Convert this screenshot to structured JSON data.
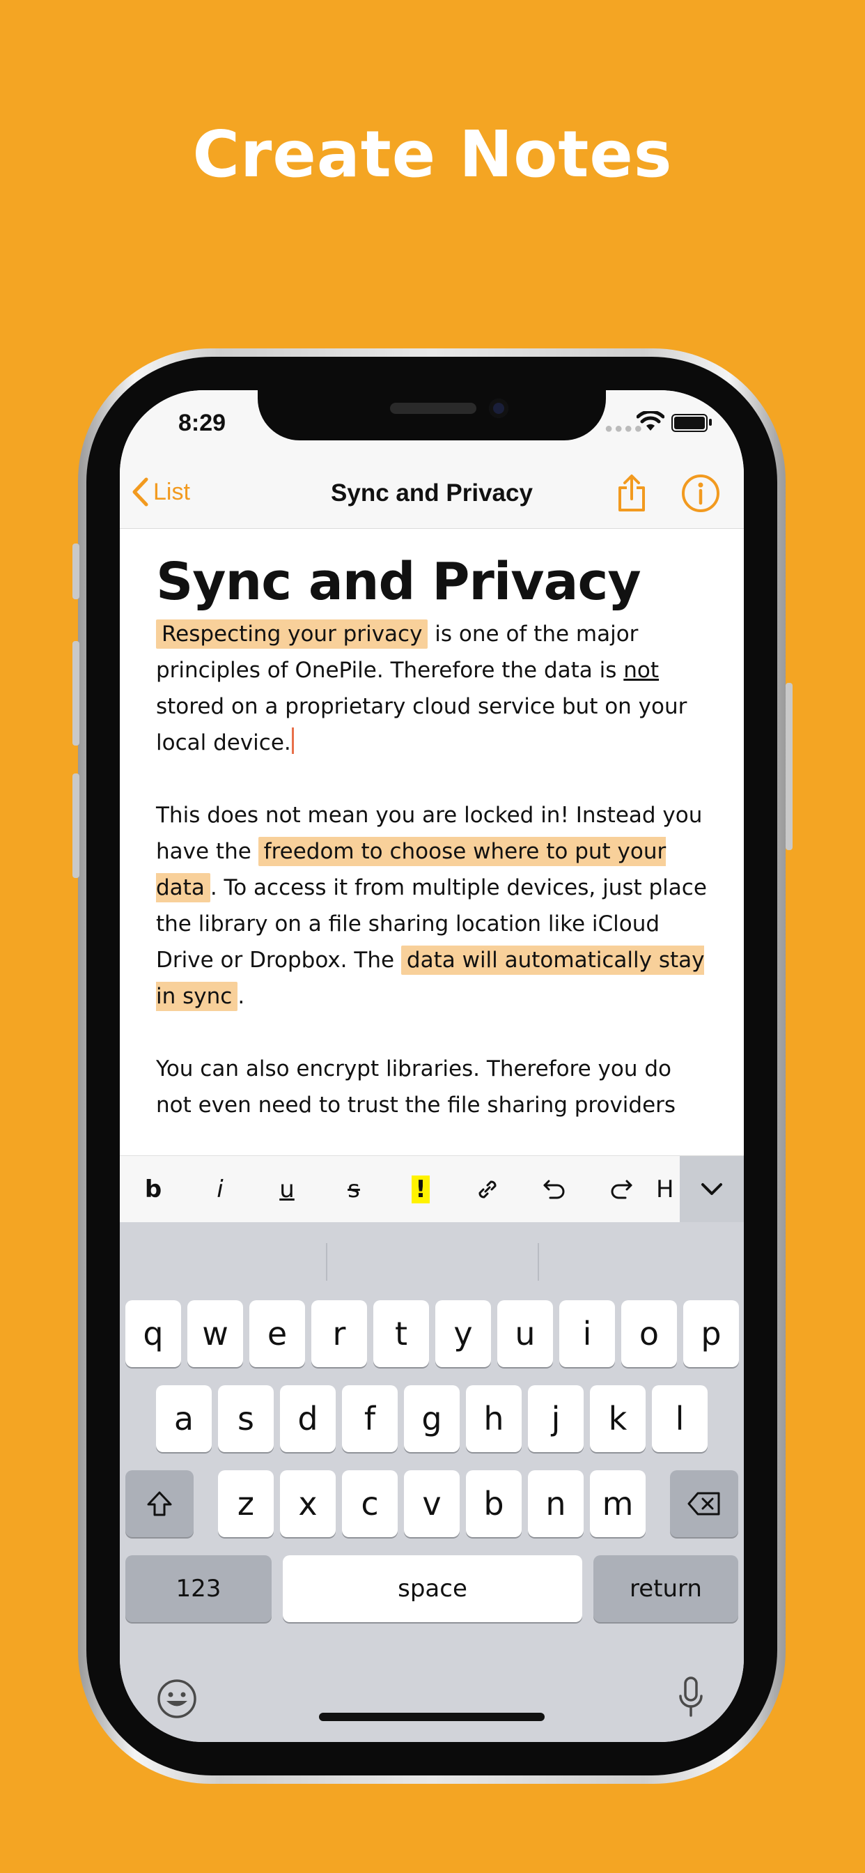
{
  "banner": {
    "headline": "Create Notes"
  },
  "status": {
    "time": "8:29"
  },
  "nav": {
    "back_label": "List",
    "title": "Sync and Privacy"
  },
  "note": {
    "title": "Sync and Privacy",
    "p1": {
      "hl1": "Respecting your privacy",
      "t1": " is one of the major principles of OnePile. Therefore the data is ",
      "u1": "not",
      "t2": " stored on a proprietary cloud service but on your local device."
    },
    "p2": {
      "t1": "This does not mean you are locked in! Instead you have the ",
      "hl1": "freedom to choose where to put your data",
      "t2": ". To access it from multiple devices, just place the library on a file sharing location like iCloud Drive or Dropbox. The ",
      "hl2": "data will automatically stay in sync",
      "t3": "."
    },
    "p3": {
      "t1": "You can also encrypt libraries. Therefore you do not even need to trust the file sharing providers"
    }
  },
  "format_toolbar": {
    "bold": "b",
    "italic": "i",
    "underline": "u",
    "strike": "s",
    "highlight": "!",
    "heading": "H"
  },
  "keyboard": {
    "row1": [
      "q",
      "w",
      "e",
      "r",
      "t",
      "y",
      "u",
      "i",
      "o",
      "p"
    ],
    "row2": [
      "a",
      "s",
      "d",
      "f",
      "g",
      "h",
      "j",
      "k",
      "l"
    ],
    "row3": [
      "z",
      "x",
      "c",
      "v",
      "b",
      "n",
      "m"
    ],
    "numbers": "123",
    "space": "space",
    "return": "return"
  },
  "colors": {
    "background": "#F4A523",
    "accent": "#F29A1F",
    "highlight": "#F8D09A"
  }
}
